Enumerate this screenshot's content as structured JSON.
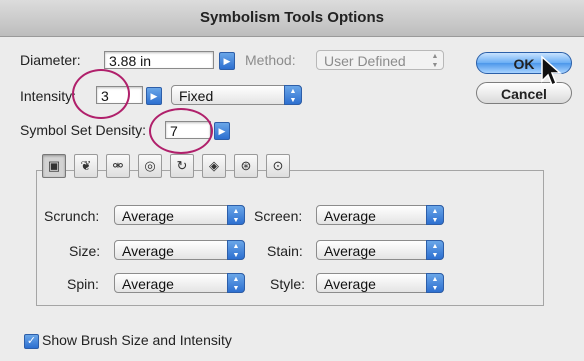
{
  "window": {
    "title": "Symbolism Tools Options"
  },
  "diameter": {
    "label": "Diameter:",
    "value": "3.88 in"
  },
  "method": {
    "label": "Method:",
    "value": "User Defined"
  },
  "intensity": {
    "label": "Intensity:",
    "value": "3",
    "mode": "Fixed"
  },
  "density": {
    "label": "Symbol Set Density:",
    "value": "7"
  },
  "buttons": {
    "ok": "OK",
    "cancel": "Cancel"
  },
  "tabs": [
    {
      "icon": "symbol-sprayer-icon",
      "glyph": "▣"
    },
    {
      "icon": "symbol-shifter-icon",
      "glyph": "❦"
    },
    {
      "icon": "symbol-scruncher-icon",
      "glyph": "⚮"
    },
    {
      "icon": "symbol-sizer-icon",
      "glyph": "◎"
    },
    {
      "icon": "symbol-spinner-icon",
      "glyph": "↻"
    },
    {
      "icon": "symbol-stainer-icon",
      "glyph": "◈"
    },
    {
      "icon": "symbol-screener-icon",
      "glyph": "⊛"
    },
    {
      "icon": "symbol-styler-icon",
      "glyph": "⊙"
    }
  ],
  "settings": {
    "scrunch": {
      "label": "Scrunch:",
      "value": "Average"
    },
    "size": {
      "label": "Size:",
      "value": "Average"
    },
    "spin": {
      "label": "Spin:",
      "value": "Average"
    },
    "screen": {
      "label": "Screen:",
      "value": "Average"
    },
    "stain": {
      "label": "Stain:",
      "value": "Average"
    },
    "style": {
      "label": "Style:",
      "value": "Average"
    }
  },
  "show_brush": {
    "label": "Show Brush Size and Intensity",
    "checked": true
  },
  "colors": {
    "accent": "#4c97ea",
    "highlight_circle": "#b0206b"
  }
}
